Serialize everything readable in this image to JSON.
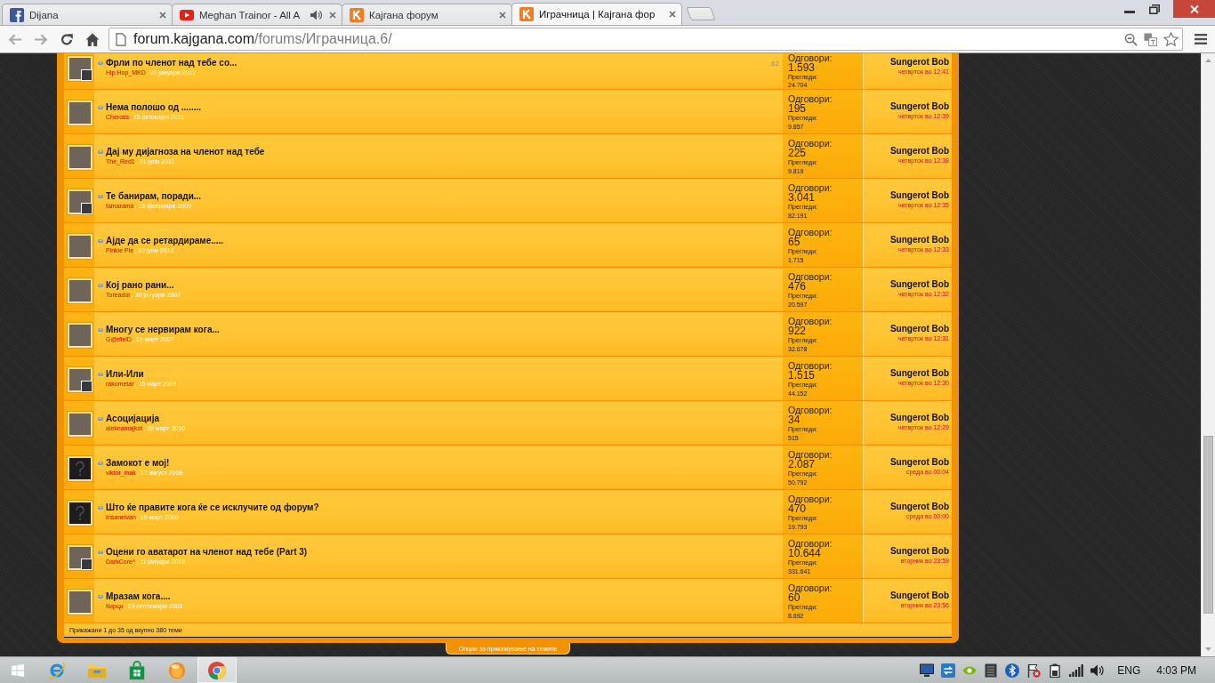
{
  "browser": {
    "tabs": [
      {
        "title": "Dijana",
        "kind": "social",
        "audio": false,
        "selected": false
      },
      {
        "title": "Meghan Trainor - All A",
        "kind": "video",
        "audio": true,
        "selected": false
      },
      {
        "title": "Кајгана форум",
        "kind": "forum",
        "audio": false,
        "selected": false
      },
      {
        "title": "Играчница | Кајгана фор",
        "kind": "forum",
        "audio": false,
        "selected": true
      }
    ],
    "address": {
      "host": "forum.kajgana.com",
      "path": "/forums/Играчница.6/"
    }
  },
  "threads": [
    {
      "title": "Фрли по членот над тебе со...",
      "author": "Hip.Hop_MKD",
      "date": ", 20 јануари 2012",
      "last_page": "62",
      "avatar": {
        "kind": "photo",
        "mini": true
      },
      "replies_label": "Одговори:",
      "replies": "1.593",
      "views_label": "Прегледи:",
      "views": "24.704",
      "last_poster": "Sungerot Bob",
      "last_time": "четврток во 12:41"
    },
    {
      "title": "Нема полошо од ........",
      "author": "Cheross",
      "date": ", 15 октомври 2011",
      "avatar": {
        "kind": "photo",
        "mini": false
      },
      "replies_label": "Одговори:",
      "replies": "195",
      "views_label": "Прегледи:",
      "views": "9.857",
      "last_poster": "Sungerot Bob",
      "last_time": "четврток во 12:39"
    },
    {
      "title": "Дај му дијагноза на членот над тебе",
      "author": "The_Red1",
      "date": ", 21 јули 2011",
      "avatar": {
        "kind": "photo",
        "mini": false
      },
      "replies_label": "Одговори:",
      "replies": "225",
      "views_label": "Прегледи:",
      "views": "9.819",
      "last_poster": "Sungerot Bob",
      "last_time": "четврток во 12:38"
    },
    {
      "title": "Те банирам, поради...",
      "author": "famarama",
      "date": ", 15 февруари 2009",
      "avatar": {
        "kind": "photo",
        "mini": true
      },
      "replies_label": "Одговори:",
      "replies": "3.041",
      "views_label": "Прегледи:",
      "views": "82.191",
      "last_poster": "Sungerot Bob",
      "last_time": "четврток во 12:35"
    },
    {
      "title": "Ајде да се ретардираме.....",
      "author": "Pinkie Pie",
      "date": ", 10 јуни 2013",
      "avatar": {
        "kind": "photo",
        "mini": false
      },
      "replies_label": "Одговори:",
      "replies": "65",
      "views_label": "Прегледи:",
      "views": "1.715",
      "last_poster": "Sungerot Bob",
      "last_time": "четврток во 12:33"
    },
    {
      "title": "Кој рано рани...",
      "author": "Toreador",
      "date": ", 30 јануари 2007",
      "avatar": {
        "kind": "photo",
        "mini": false
      },
      "replies_label": "Одговори:",
      "replies": "476",
      "views_label": "Прегледи:",
      "views": "20.597",
      "last_poster": "Sungerot Bob",
      "last_time": "четврток во 12:32"
    },
    {
      "title": "Многу се нервирам кога...",
      "author": "G@rfielD",
      "date": ", 19 март 2007",
      "avatar": {
        "kind": "photo",
        "mini": false
      },
      "replies_label": "Одговори:",
      "replies": "922",
      "views_label": "Прегледи:",
      "views": "32.678",
      "last_poster": "Sungerot Bob",
      "last_time": "четврток во 12:31"
    },
    {
      "title": "Или-Или",
      "author": "rakometar",
      "date": ", 16 март 2009",
      "avatar": {
        "kind": "photo",
        "mini": true
      },
      "replies_label": "Одговори:",
      "replies": "1.515",
      "views_label": "Прегледи:",
      "views": "44.152",
      "last_poster": "Sungerot Bob",
      "last_time": "четврток во 12:30"
    },
    {
      "title": "Асоцијација",
      "author": "aleknamajkot",
      "date": ", 28 март 2010",
      "avatar": {
        "kind": "photo",
        "mini": false
      },
      "replies_label": "Одговори:",
      "replies": "34",
      "views_label": "Прегледи:",
      "views": "515",
      "last_poster": "Sungerot Bob",
      "last_time": "четврток во 12:29"
    },
    {
      "title": "Замокот е мој!",
      "author": "viktor_mak",
      "date": ", 17 август 2008",
      "avatar": {
        "kind": "default",
        "mini": false
      },
      "replies_label": "Одговори:",
      "replies": "2.087",
      "views_label": "Прегледи:",
      "views": "50.792",
      "last_poster": "Sungerot Bob",
      "last_time": "среда во 00:04"
    },
    {
      "title": "Што ќе правите кога ќе се исклучите од форум?",
      "author": "Insaneivan",
      "date": ", 15 март 2009",
      "avatar": {
        "kind": "default",
        "mini": false
      },
      "replies_label": "Одговори:",
      "replies": "470",
      "views_label": "Прегледи:",
      "views": "19.793",
      "last_poster": "Sungerot Bob",
      "last_time": "среда во 00:00"
    },
    {
      "title": "Оцени го аватарот на членот над тебе (Part 3)",
      "author": "DarkCore^",
      "date": ", 11 јануари 2008",
      "avatar": {
        "kind": "photo",
        "mini": true
      },
      "replies_label": "Одговори:",
      "replies": "10.644",
      "views_label": "Прегледи:",
      "views": "331.641",
      "last_poster": "Sungerot Bob",
      "last_time": "вторник во 23:59"
    },
    {
      "title": "Мразам кога....",
      "author": "Кирцо",
      "date": ", 23 септември 2008",
      "avatar": {
        "kind": "photo",
        "mini": false
      },
      "replies_label": "Одговори:",
      "replies": "60",
      "views_label": "Прегледи:",
      "views": "8.692",
      "last_poster": "Sungerot Bob",
      "last_time": "вторник во 23:56"
    }
  ],
  "footer": {
    "summary": "Прикажани 1 до 35 од вкупно 380 теми",
    "options_tab": "Опции за прикажување на темите"
  },
  "taskbar": {
    "apps": [
      {
        "kind": "ie",
        "selected": false
      },
      {
        "kind": "explorer",
        "selected": false
      },
      {
        "kind": "store",
        "selected": false
      },
      {
        "kind": "player",
        "selected": false
      },
      {
        "kind": "chrome",
        "selected": true
      }
    ],
    "language": "ENG",
    "clock": "4:03 PM"
  }
}
